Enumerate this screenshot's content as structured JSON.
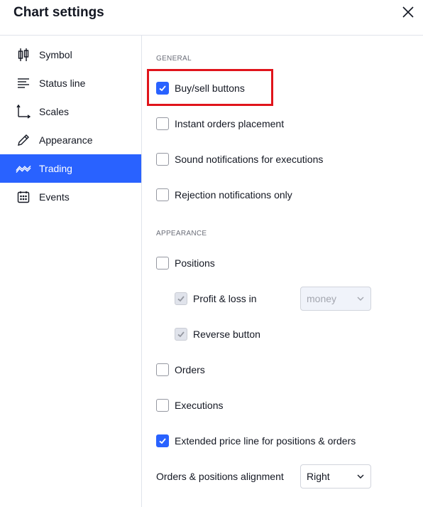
{
  "dialog": {
    "title": "Chart settings"
  },
  "sidebar": {
    "items": [
      {
        "label": "Symbol",
        "icon": "candlestick-icon",
        "active": false
      },
      {
        "label": "Status line",
        "icon": "status-line-icon",
        "active": false
      },
      {
        "label": "Scales",
        "icon": "scales-icon",
        "active": false
      },
      {
        "label": "Appearance",
        "icon": "pencil-icon",
        "active": false
      },
      {
        "label": "Trading",
        "icon": "trading-wave-icon",
        "active": true
      },
      {
        "label": "Events",
        "icon": "calendar-icon",
        "active": false
      }
    ]
  },
  "general": {
    "section_label": "GENERAL",
    "buy_sell": {
      "label": "Buy/sell buttons",
      "checked": true
    },
    "instant_orders": {
      "label": "Instant orders placement",
      "checked": false
    },
    "sound_notifications": {
      "label": "Sound notifications for executions",
      "checked": false
    },
    "rejection_notifications": {
      "label": "Rejection notifications only",
      "checked": false
    }
  },
  "appearance": {
    "section_label": "APPEARANCE",
    "positions": {
      "label": "Positions",
      "checked": false
    },
    "profit_loss": {
      "label": "Profit & loss in",
      "checked": true,
      "disabled": true,
      "select_value": "money"
    },
    "reverse_button": {
      "label": "Reverse button",
      "checked": true,
      "disabled": true
    },
    "orders": {
      "label": "Orders",
      "checked": false
    },
    "executions": {
      "label": "Executions",
      "checked": false
    },
    "extended_price_line": {
      "label": "Extended price line for positions & orders",
      "checked": true
    },
    "alignment": {
      "label": "Orders & positions alignment",
      "select_value": "Right"
    }
  },
  "colors": {
    "accent": "#2962ff",
    "highlight": "#e0141b",
    "text": "#131722",
    "muted": "#6a6d78"
  }
}
